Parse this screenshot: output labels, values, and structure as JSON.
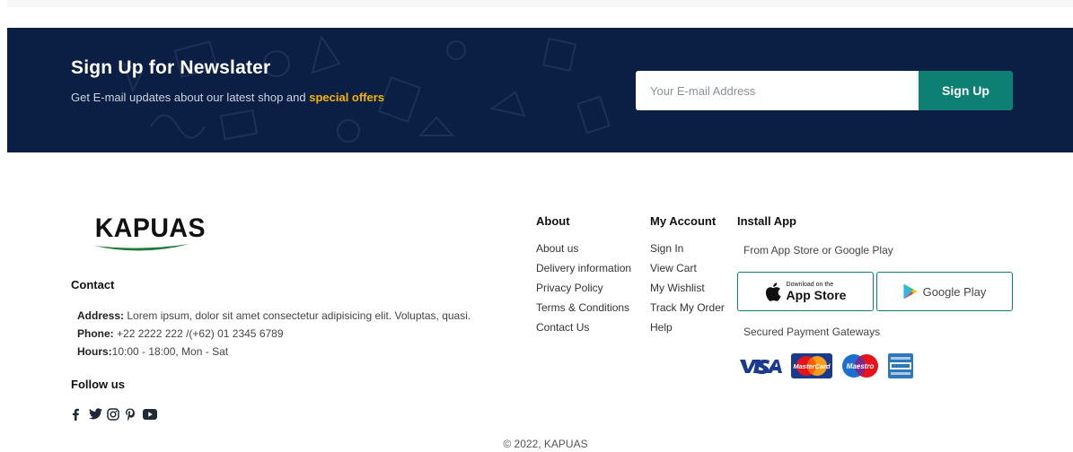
{
  "newsletter": {
    "title": "Sign Up for Newslater",
    "subtitle_prefix": "Get E-mail updates about our latest shop and ",
    "subtitle_accent": "special offers",
    "input_placeholder": "Your E-mail Address",
    "button_label": "Sign Up",
    "colors": {
      "band": "#0b1f44",
      "accent": "#f5b400",
      "button": "#0d7f73"
    }
  },
  "brand": {
    "logo_text": "KAPUAS"
  },
  "contact": {
    "heading": "Contact",
    "address_label": "Address:",
    "address_value": "Lorem ipsum, dolor sit amet consectetur adipisicing elit. Voluptas, quasi.",
    "phone_label": "Phone:",
    "phone_value": "+22 2222 222 /(+62) 01 2345 6789",
    "hours_label": "Hours:",
    "hours_value": "10:00 - 18:00, Mon - Sat"
  },
  "follow": {
    "heading": "Follow us",
    "icons": [
      "facebook-icon",
      "twitter-icon",
      "instagram-icon",
      "pinterest-icon",
      "youtube-icon"
    ]
  },
  "about": {
    "heading": "About",
    "links": [
      "About us",
      "Delivery information",
      "Privacy Policy",
      "Terms & Conditions",
      "Contact Us"
    ]
  },
  "account": {
    "heading": "My Account",
    "links": [
      "Sign In",
      "View Cart",
      "My Wishlist",
      "Track My Order",
      "Help"
    ]
  },
  "install": {
    "heading": "Install App",
    "note": "From App Store or Google Play",
    "apple_small": "Download on the",
    "apple_large": "App Store",
    "google_label": "Google Play",
    "payment_note": "Secured Payment Gateways",
    "payment_icons": [
      "visa-icon",
      "mastercard-icon",
      "maestro-icon",
      "amex-icon"
    ]
  },
  "footer": {
    "copyright": "© 2022, KAPUAS"
  }
}
